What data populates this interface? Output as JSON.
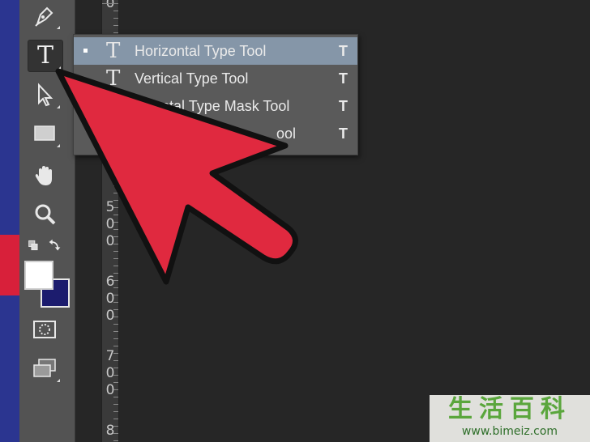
{
  "toolbar": {
    "tools": [
      {
        "name": "pen-tool",
        "icon": "pen-icon"
      },
      {
        "name": "type-tool",
        "icon": "type-icon",
        "glyph": "T",
        "selected": true
      },
      {
        "name": "path-selection-tool",
        "icon": "arrow-pointer-icon"
      },
      {
        "name": "rectangle-tool",
        "icon": "rectangle-icon"
      },
      {
        "name": "hand-tool",
        "icon": "hand-icon"
      },
      {
        "name": "zoom-tool",
        "icon": "magnifier-icon"
      },
      {
        "name": "swap-colors",
        "icon": "swap-colors-icon"
      },
      {
        "name": "color-swatches",
        "icon": "color-swatches-icon",
        "foreground": "#ffffff",
        "background": "#1c1c6e"
      },
      {
        "name": "quick-mask",
        "icon": "quick-mask-icon"
      },
      {
        "name": "screen-mode",
        "icon": "screen-mode-icon"
      }
    ]
  },
  "ruler": {
    "labels": [
      {
        "text": "0"
      },
      {
        "text": "5\n0\n0"
      },
      {
        "text": "6\n0\n0"
      },
      {
        "text": "7\n0\n0"
      },
      {
        "text": "8"
      }
    ]
  },
  "flyout": {
    "items": [
      {
        "glyph": "T",
        "label": "Horizontal Type Tool",
        "shortcut": "T",
        "active": true
      },
      {
        "glyph": "T",
        "label": "Vertical Type Tool",
        "shortcut": "T",
        "active": false
      },
      {
        "glyph": "T",
        "label": "ntal Type Mask Tool",
        "shortcut": "T",
        "active": false
      },
      {
        "glyph": "T",
        "label": "ool",
        "shortcut": "T",
        "active": false
      }
    ]
  },
  "annotation": {
    "icon": "red-arrow-icon",
    "color": "#e0293f"
  },
  "watermark": {
    "title": "生活百科",
    "url": "www.bimeiz.com"
  },
  "colors": {
    "canvas": "#262626",
    "toolbar": "#535353",
    "flyout": "#5a5a5a",
    "highlight": "#8596a8",
    "stripe_blue": "#2b3590",
    "stripe_red": "#d8203a"
  }
}
